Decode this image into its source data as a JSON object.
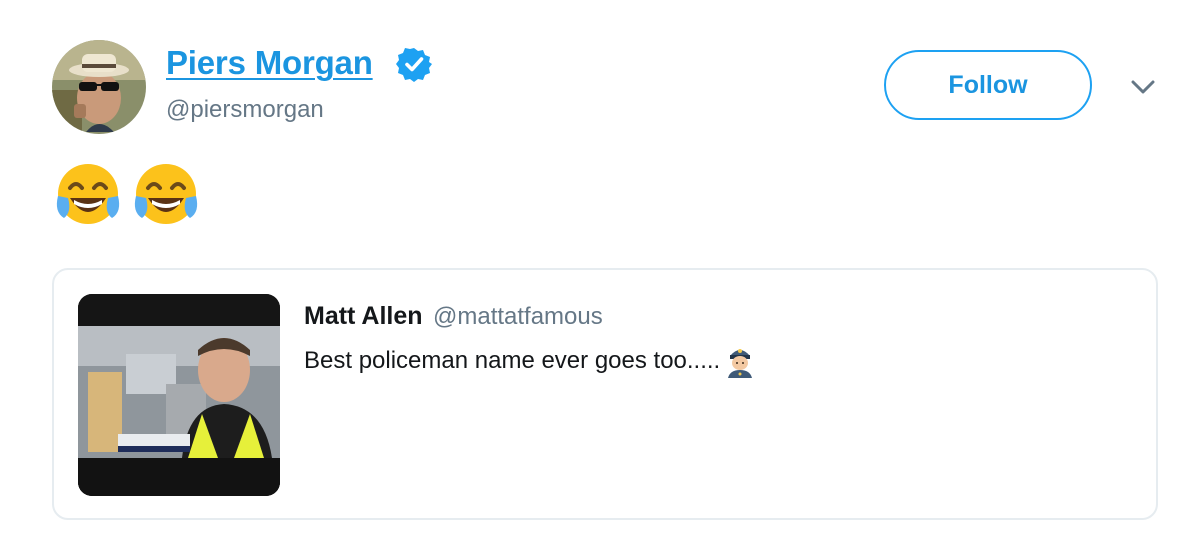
{
  "tweet": {
    "author": {
      "name": "Piers Morgan",
      "handle": "@piersmorgan",
      "verified": true,
      "avatar": "avatar-photo"
    },
    "follow_label": "Follow",
    "more_icon": "chevron-down-icon",
    "text_emojis": [
      "face-with-tears-of-joy",
      "face-with-tears-of-joy"
    ],
    "quoted_tweet": {
      "author_name": "Matt Allen",
      "author_handle": "@mattatfamous",
      "text": "Best policeman name ever goes too.....",
      "trailing_emoji": "police-officer",
      "media": "tv-news-screenshot"
    }
  },
  "colors": {
    "link_blue": "#1b95e0",
    "button_border": "#1da1f2",
    "secondary_text": "#657786",
    "primary_text": "#14171a",
    "card_border": "#e6ecf0"
  }
}
